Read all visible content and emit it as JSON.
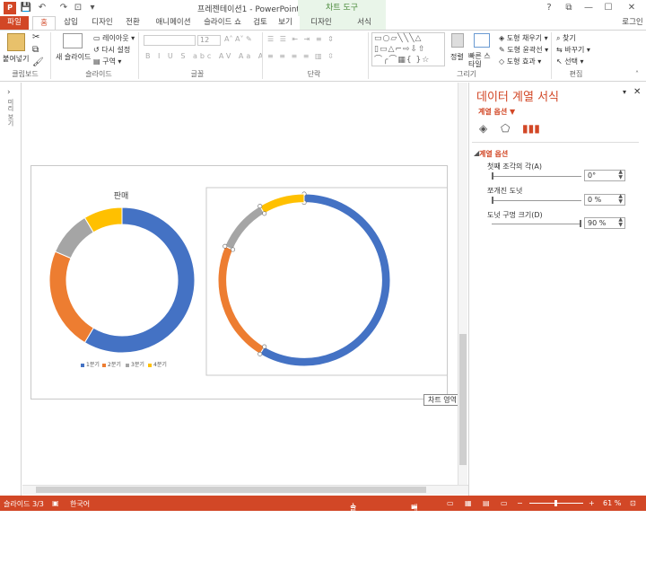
{
  "titlebar": {
    "app_badge": "P",
    "title": "프레젠테이션1 - PowerPoint",
    "context_group": "차트 도구",
    "window_buttons": [
      "?",
      "⧉",
      "—",
      "☐",
      "✕"
    ]
  },
  "tabs": {
    "file": "파일",
    "home": "홈",
    "items": [
      "삽입",
      "디자인",
      "전환",
      "애니메이션",
      "슬라이드 쇼",
      "검토",
      "보기"
    ],
    "context": [
      "디자인",
      "서식"
    ],
    "login": "로그인"
  },
  "ribbon": {
    "clipboard": {
      "paste": "붙여넣기",
      "label": "클립보드"
    },
    "slides": {
      "new_slide": "새 슬라이드",
      "layout": "레이아웃",
      "reset": "다시 설정",
      "section": "구역",
      "label": "슬라이드"
    },
    "font": {
      "font_size": "12",
      "label": "글꼴"
    },
    "paragraph": {
      "label": "단락"
    },
    "drawing": {
      "arrange": "정렬",
      "quick_styles": "빠른 스타일",
      "fill": "도형 채우기",
      "outline": "도형 윤곽선",
      "effects": "도형 효과",
      "label": "그리기"
    },
    "editing": {
      "find": "찾기",
      "replace": "바꾸기",
      "select": "선택",
      "label": "편집"
    }
  },
  "thumbs_label": "미리 보기",
  "chart_data": [
    {
      "type": "pie",
      "variant": "donut",
      "title": "판매",
      "categories": [
        "1분기",
        "2분기",
        "3분기",
        "4분기"
      ],
      "values": [
        8.2,
        3.2,
        1.4,
        1.2
      ],
      "colors": [
        "#4472c4",
        "#ed7d31",
        "#a5a5a5",
        "#ffc000"
      ],
      "legend": "bottom"
    },
    {
      "type": "pie",
      "variant": "donut",
      "title": "",
      "categories": [
        "1분기",
        "2분기",
        "3분기",
        "4분기"
      ],
      "values": [
        8.2,
        3.2,
        1.4,
        1.2
      ],
      "colors": [
        "#4472c4",
        "#ed7d31",
        "#a5a5a5",
        "#ffc000"
      ],
      "hole_size_percent": 90,
      "selected": true
    }
  ],
  "tooltip": "차트 영역",
  "pane": {
    "title": "데이터 계열 서식",
    "subtitle": "계열 옵션 ▼",
    "section": "계열 옵션",
    "first_slice_angle_label": "첫째 조각의 각(A)",
    "first_slice_angle": "0°",
    "explosion_label": "쪼개진 도넛",
    "explosion": "0 %",
    "hole_size_label": "도넛 구멍 크기(D)",
    "hole_size": "90 %"
  },
  "status": {
    "slide": "슬라이드 3/3",
    "language": "한국어",
    "notes": "슬라이드 노트",
    "comments": "메모",
    "zoom": "61 %"
  }
}
